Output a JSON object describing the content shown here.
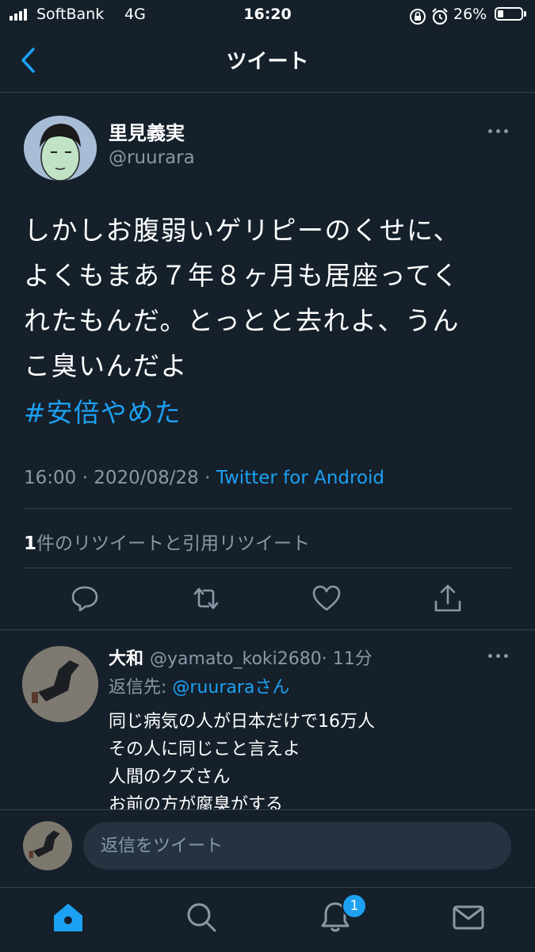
{
  "status_bar": {
    "carrier": "SoftBank",
    "network": "4G",
    "time": "16:20",
    "battery_percent": "26%",
    "battery_level": 0.26
  },
  "nav": {
    "title": "ツイート"
  },
  "tweet": {
    "author_name": "里見義実",
    "author_handle": "@ruurara",
    "text": "しかしお腹弱いゲリピーのくせに、\nよくもまあ７年８ヶ月も居座ってく\nれたもんだ。とっとと去れよ、うん\nこ臭いんだよ",
    "hashtag": "#安倍やめた",
    "time": "16:00",
    "separator": " · ",
    "date": "2020/08/28",
    "separator2": " · ",
    "source": "Twitter for Android",
    "retweet_count": "1",
    "retweet_label": "件のリツイートと引用リツイート"
  },
  "reply": {
    "name": "大和",
    "handle": "@yamato_koki2680",
    "time_ago": "· 11分",
    "replying_prefix": "返信先: ",
    "replying_to": "@ruuraraさん",
    "lines": [
      "同じ病気の人が日本だけで16万人",
      "その人に同じこと言えよ",
      "人間のクズさん",
      "お前の方が腐臭がする"
    ]
  },
  "compose": {
    "placeholder": "返信をツイート"
  },
  "tabbar": {
    "notification_badge": "1"
  },
  "colors": {
    "background": "#15202b",
    "accent": "#1da1f2",
    "secondary_text": "#8899a6",
    "divider": "#38444d"
  },
  "icons": {
    "back": "chevron-left-icon",
    "more": "more-dots-icon",
    "reply": "reply-bubble-icon",
    "retweet": "retweet-icon",
    "like": "heart-icon",
    "share": "share-icon",
    "home": "home-icon",
    "search": "search-icon",
    "notifications": "bell-icon",
    "messages": "mail-icon"
  }
}
